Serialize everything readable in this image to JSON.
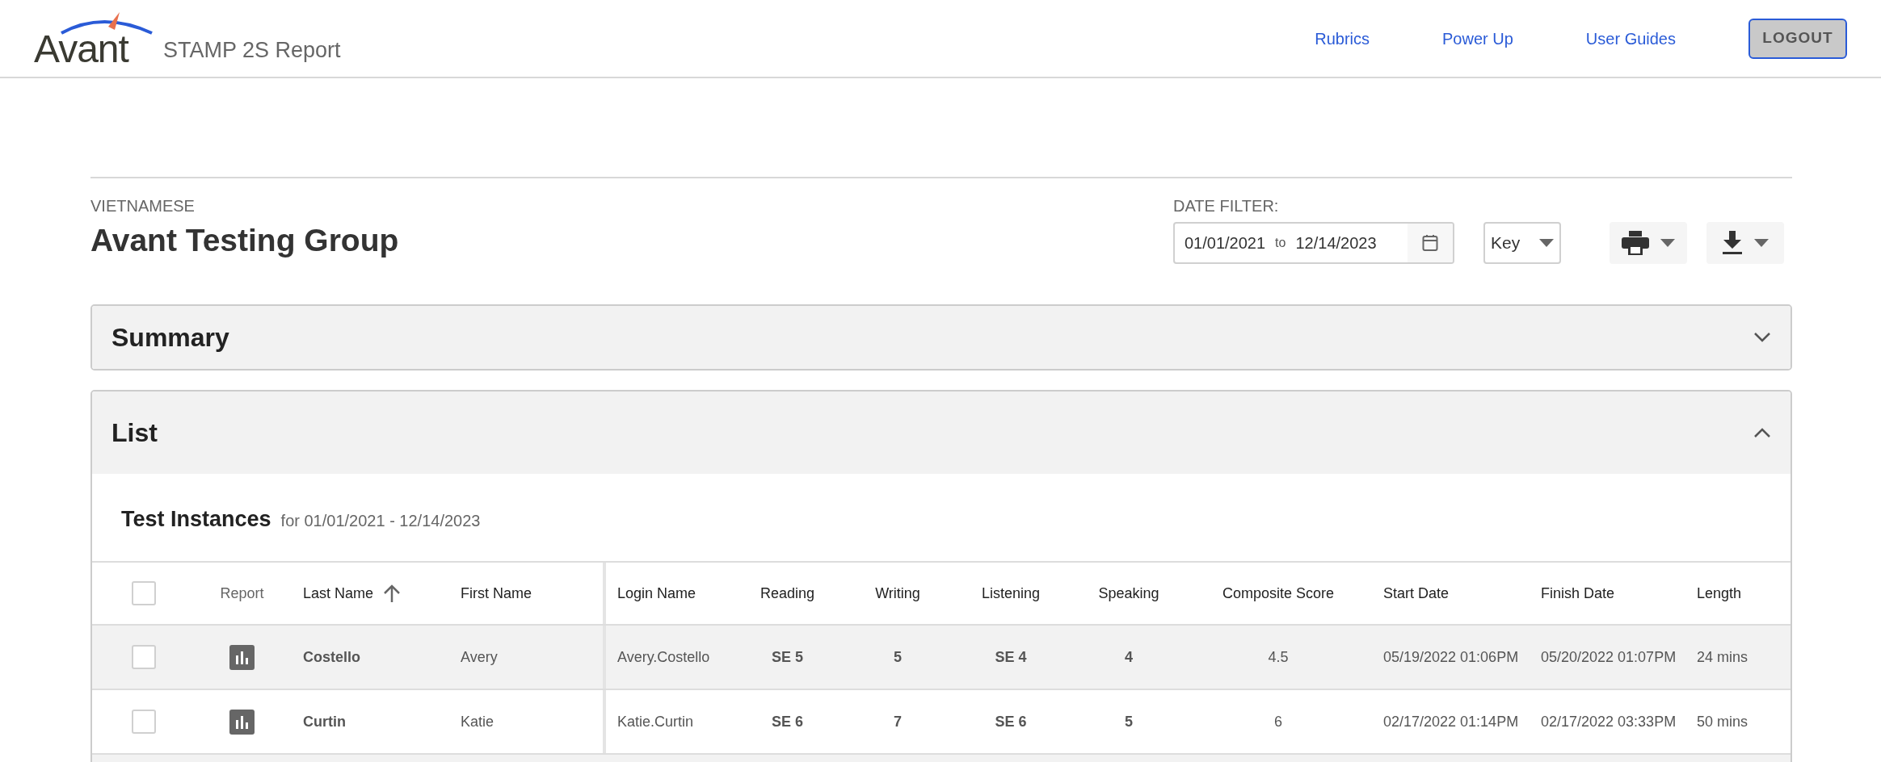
{
  "header": {
    "logo_text": "Avant",
    "product": "STAMP 2S Report",
    "nav": [
      "Rubrics",
      "Power Up",
      "User Guides"
    ],
    "logout": "LOGOUT"
  },
  "group": {
    "language": "VIETNAMESE",
    "title": "Avant Testing Group"
  },
  "date_filter": {
    "label": "DATE FILTER:",
    "from": "01/01/2021",
    "separator": "to",
    "to": "12/14/2023"
  },
  "key_dropdown": "Key",
  "panels": [
    {
      "title": "Summary",
      "expanded": false
    },
    {
      "title": "List",
      "expanded": true
    }
  ],
  "list": {
    "heading": "Test Instances",
    "range": "for 01/01/2021 - 12/14/2023",
    "columns": [
      {
        "kind": "checkbox",
        "checked": false
      },
      {
        "kind": "text",
        "label": "Report"
      },
      {
        "kind": "text",
        "label": "Last Name",
        "sorted": true
      },
      {
        "kind": "text",
        "label": "First Name"
      },
      {
        "kind": "text",
        "label": "Login Name"
      },
      {
        "kind": "text",
        "label": "Reading"
      },
      {
        "kind": "text",
        "label": "Writing"
      },
      {
        "kind": "text",
        "label": "Listening"
      },
      {
        "kind": "text",
        "label": "Speaking"
      },
      {
        "kind": "text",
        "label": "Composite Score"
      },
      {
        "kind": "text",
        "label": "Start Date"
      },
      {
        "kind": "text",
        "label": "Finish Date"
      },
      {
        "kind": "text",
        "label": "Length"
      }
    ],
    "rows": [
      {
        "checked": false,
        "last_name": "Costello",
        "first_name": "Avery",
        "login": "Avery.Costello",
        "reading": "SE 5",
        "writing": "5",
        "listening": "SE 4",
        "speaking": "4",
        "composite": "4.5",
        "start": "05/19/2022 01:06PM",
        "finish": "05/20/2022 01:07PM",
        "length": "24 mins"
      },
      {
        "checked": false,
        "last_name": "Curtin",
        "first_name": "Katie",
        "login": "Katie.Curtin",
        "reading": "SE 6",
        "writing": "7",
        "listening": "SE 6",
        "speaking": "5",
        "composite": "6",
        "start": "02/17/2022 01:14PM",
        "finish": "02/17/2022 03:33PM",
        "length": "50 mins"
      }
    ]
  }
}
